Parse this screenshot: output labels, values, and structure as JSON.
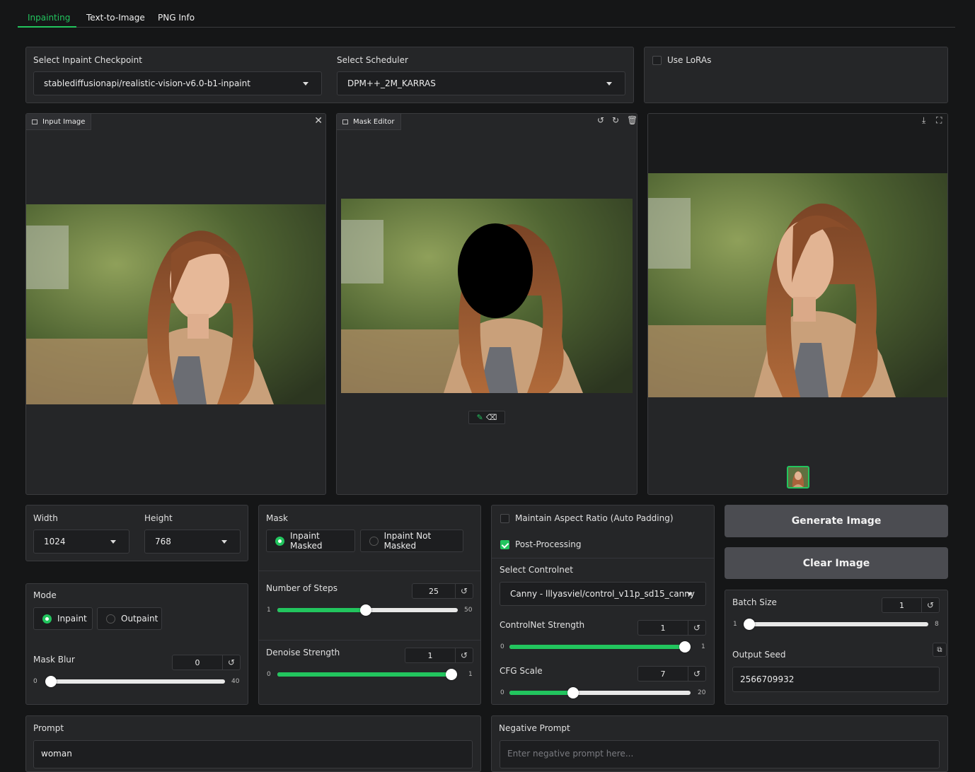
{
  "tabs": [
    {
      "label": "Inpainting",
      "active": true
    },
    {
      "label": "Text-to-Image",
      "active": false
    },
    {
      "label": "PNG Info",
      "active": false
    }
  ],
  "checkpoint": {
    "label": "Select Inpaint Checkpoint",
    "value": "stablediffusionapi/realistic-vision-v6.0-b1-inpaint"
  },
  "scheduler": {
    "label": "Select Scheduler",
    "value": "DPM++_2M_KARRAS"
  },
  "loras": {
    "label": "Use LoRAs",
    "checked": false
  },
  "input_image": {
    "label": "Input Image"
  },
  "mask_editor": {
    "label": "Mask Editor"
  },
  "width": {
    "label": "Width",
    "value": "1024"
  },
  "height": {
    "label": "Height",
    "value": "768"
  },
  "mode": {
    "label": "Mode",
    "options": [
      "Inpaint",
      "Outpaint"
    ],
    "selected": "Inpaint"
  },
  "mask_blur": {
    "label": "Mask Blur",
    "value": "0",
    "min": "0",
    "max": "40",
    "fraction": 0.0
  },
  "mask": {
    "label": "Mask",
    "options": [
      "Inpaint Masked",
      "Inpaint Not Masked"
    ],
    "selected": "Inpaint Masked"
  },
  "steps": {
    "label": "Number of Steps",
    "value": "25",
    "min": "1",
    "max": "50",
    "fraction": 0.49
  },
  "denoise": {
    "label": "Denoise Strength",
    "value": "1",
    "min": "0",
    "max": "1",
    "fraction": 1.0
  },
  "aspect": {
    "label": "Maintain Aspect Ratio (Auto Padding)",
    "checked": false
  },
  "postproc": {
    "label": "Post-Processing",
    "checked": true
  },
  "controlnet": {
    "label": "Select Controlnet",
    "value": "Canny - lllyasviel/control_v11p_sd15_canny"
  },
  "cn_strength": {
    "label": "ControlNet Strength",
    "value": "1",
    "min": "0",
    "max": "1",
    "fraction": 1.0
  },
  "cfg": {
    "label": "CFG Scale",
    "value": "7",
    "min": "0",
    "max": "20",
    "fraction": 0.35
  },
  "generate": {
    "label": "Generate Image"
  },
  "clear": {
    "label": "Clear Image"
  },
  "batch": {
    "label": "Batch Size",
    "value": "1",
    "min": "1",
    "max": "8",
    "fraction": 0.0
  },
  "seed": {
    "label": "Output Seed",
    "value": "2566709932"
  },
  "prompt": {
    "label": "Prompt",
    "value": "woman"
  },
  "negative": {
    "label": "Negative Prompt",
    "placeholder": "Enter negative prompt here..."
  },
  "colors": {
    "accent": "#22c55e",
    "panel": "#252628",
    "background": "#151617"
  },
  "icons": [
    "close-icon",
    "undo-icon",
    "redo-icon",
    "trash-icon",
    "download-icon",
    "fullscreen-icon",
    "brush-icon",
    "eraser-icon",
    "reset-icon",
    "copy-icon",
    "image-icon"
  ]
}
